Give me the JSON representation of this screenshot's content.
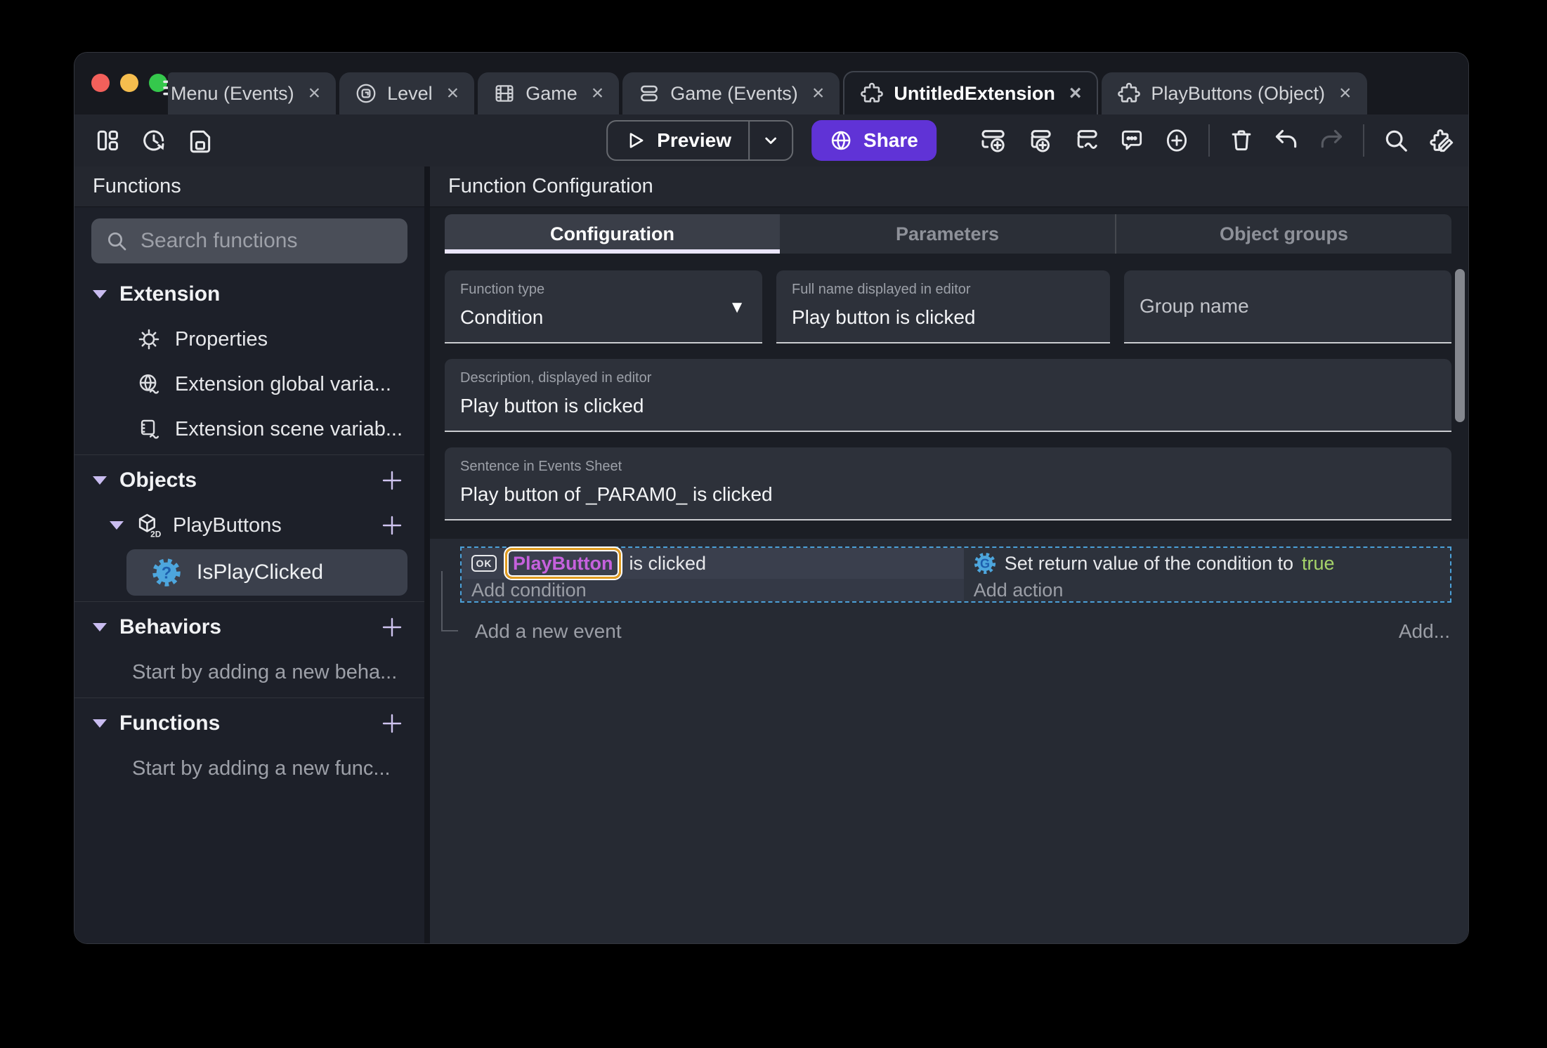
{
  "window": {
    "tabs": [
      {
        "label": "Menu (Events)",
        "active": false
      },
      {
        "label": "Level",
        "active": false
      },
      {
        "label": "Game",
        "active": false
      },
      {
        "label": "Game (Events)",
        "active": false
      },
      {
        "label": "UntitledExtension",
        "active": true
      },
      {
        "label": "PlayButtons (Object)",
        "active": false
      }
    ],
    "toolbar": {
      "preview_label": "Preview",
      "share_label": "Share"
    }
  },
  "sidebar": {
    "title": "Functions",
    "search_placeholder": "Search functions",
    "extension_section": {
      "label": "Extension",
      "items": [
        "Properties",
        "Extension global varia...",
        "Extension scene variab..."
      ]
    },
    "objects_section": {
      "label": "Objects",
      "object_label": "PlayButtons",
      "function_label": "IsPlayClicked"
    },
    "behaviors_section": {
      "label": "Behaviors",
      "hint": "Start by adding a new beha..."
    },
    "functions_section": {
      "label": "Functions",
      "hint": "Start by adding a new func..."
    }
  },
  "main": {
    "title": "Function Configuration",
    "tabs": [
      "Configuration",
      "Parameters",
      "Object groups"
    ],
    "form": {
      "function_type": {
        "label": "Function type",
        "value": "Condition"
      },
      "full_name": {
        "label": "Full name displayed in editor",
        "value": "Play button is clicked"
      },
      "group_name": {
        "placeholder": "Group name"
      },
      "description": {
        "label": "Description, displayed in editor",
        "value": "Play button is clicked"
      },
      "sentence": {
        "label": "Sentence in Events Sheet",
        "value": "Play button of _PARAM0_ is clicked"
      }
    },
    "events": {
      "condition": {
        "icon_label": "OK",
        "object": "PlayButton",
        "text": " is clicked"
      },
      "add_condition": "Add condition",
      "action": {
        "text": "Set return value of the condition to ",
        "value": "true"
      },
      "add_action": "Add action",
      "add_new_event": "Add a new event",
      "add_more": "Add..."
    }
  },
  "icons": {
    "close": "×",
    "dropdown_triangle": "▼",
    "two_d": "2D",
    "question_mark": "?",
    "gdevelop_g": "G"
  },
  "colors": {
    "accent_purple": "#6033d6",
    "tab_underline": "#eae5fa",
    "object_highlight_border": "#e09b1f",
    "object_text_purple": "#c661dd",
    "true_value_green": "#a5d36a",
    "selection_dashed_blue": "#4ba0d8",
    "traffic_red": "#f3605b",
    "traffic_yellow": "#f5bd4e",
    "traffic_green": "#35c84c"
  }
}
